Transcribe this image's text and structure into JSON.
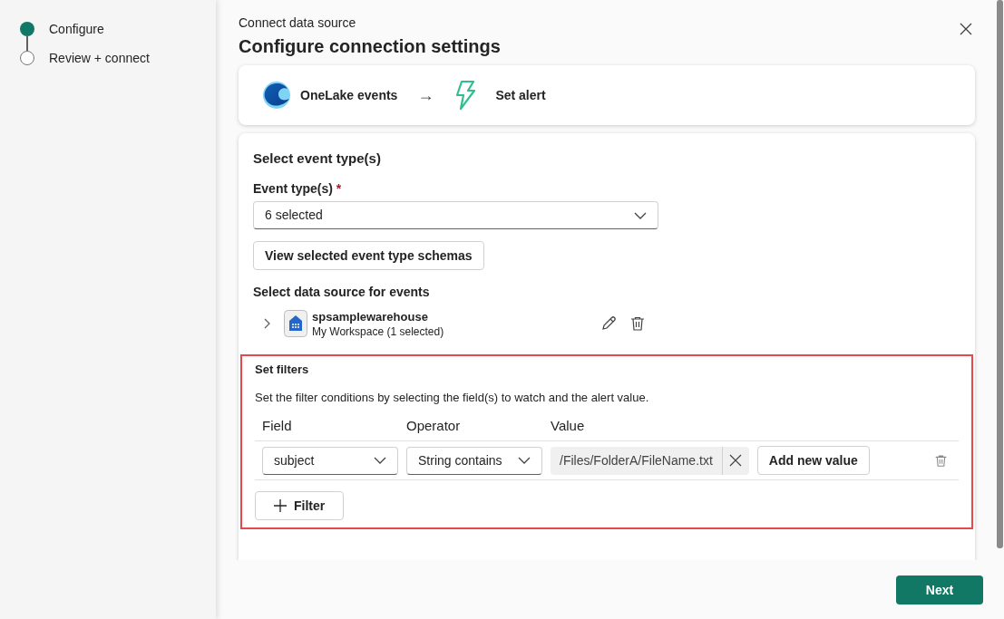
{
  "steps": [
    {
      "label": "Configure",
      "selected": true
    },
    {
      "label": "Review + connect",
      "selected": false
    }
  ],
  "header": {
    "subtitle": "Connect data source",
    "title": "Configure connection settings"
  },
  "flow": {
    "source": "OneLake events",
    "arrow": "→",
    "target": "Set alert"
  },
  "event_types": {
    "section_title": "Select event type(s)",
    "label": "Event type(s)",
    "required_mark": "*",
    "value": "6 selected",
    "schema_button": "View selected event type schemas"
  },
  "data_source": {
    "section_title": "Select data source for events",
    "name": "spsamplewarehouse",
    "detail": "My Workspace (1 selected)",
    "expanded": false
  },
  "filters": {
    "title": "Set filters",
    "description": "Set the filter conditions by selecting the field(s) to watch and the alert value.",
    "columns": [
      "Field",
      "Operator",
      "Value"
    ],
    "rows": [
      {
        "field": "subject",
        "operator": "String contains",
        "values": [
          "/Files/FolderA/FileName.txt"
        ],
        "add_value_button": "Add new value"
      }
    ],
    "add_filter_button": "Filter"
  },
  "footer": {
    "next_button": "Next"
  }
}
